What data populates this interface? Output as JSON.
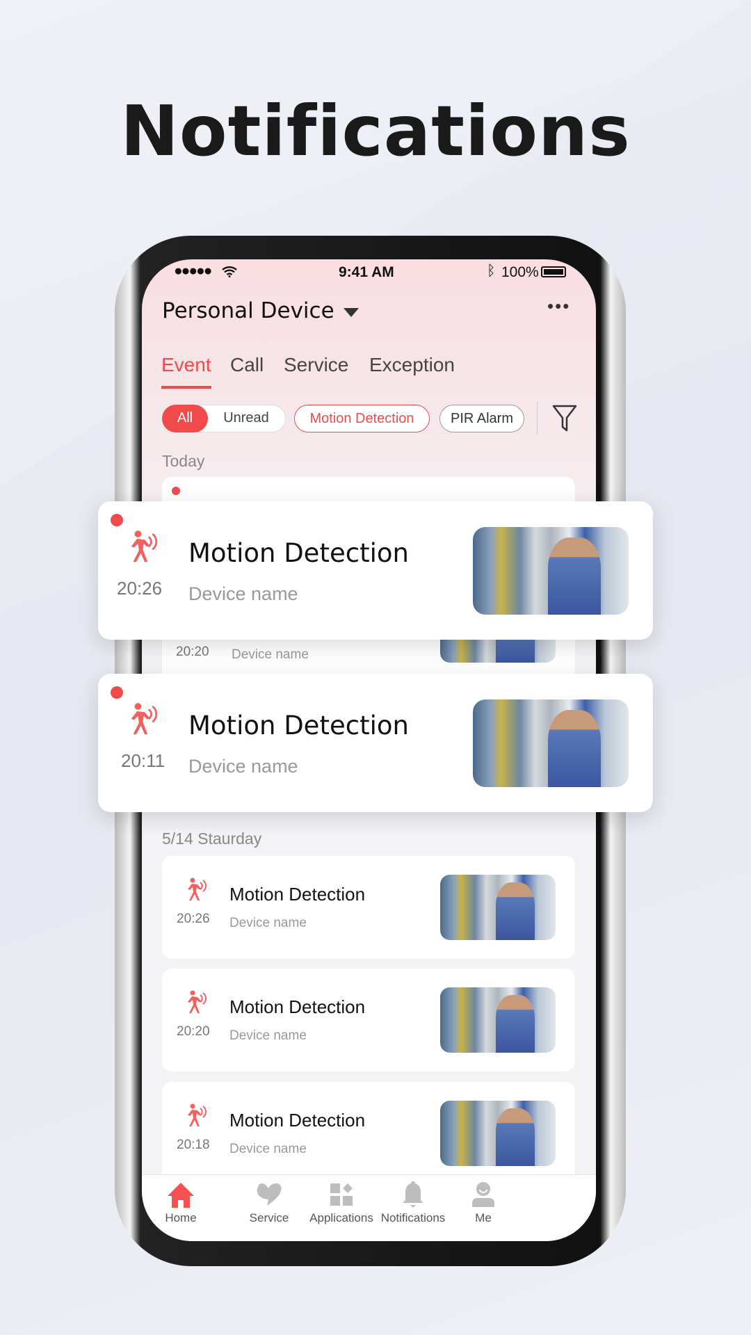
{
  "headline": "Notifications",
  "status_bar": {
    "time": "9:41 AM",
    "battery": "100%"
  },
  "header": {
    "title": "Personal Device"
  },
  "tabs": [
    {
      "label": "Event",
      "active": true
    },
    {
      "label": "Call"
    },
    {
      "label": "Service"
    },
    {
      "label": "Exception"
    }
  ],
  "filters": {
    "all": "All",
    "unread": "Unread",
    "chips": [
      "Motion Detection",
      "PIR Alarm"
    ]
  },
  "sections": {
    "today": "Today",
    "earlier": "5/14 Staurday"
  },
  "today_items": [
    {
      "title": "Motion Detection",
      "device": "Device name",
      "time": "20:26",
      "unread": true
    },
    {
      "title": "Motion Detection",
      "device": "Device name",
      "time": "20:20",
      "unread": false
    },
    {
      "title": "Motion Detection",
      "device": "Device name",
      "time": "20:11",
      "unread": true
    }
  ],
  "earlier_items": [
    {
      "title": "Motion Detection",
      "device": "Device name",
      "time": "20:26"
    },
    {
      "title": "Motion Detection",
      "device": "Device name",
      "time": "20:20"
    },
    {
      "title": "Motion Detection",
      "device": "Device name",
      "time": "20:18"
    }
  ],
  "bottom_nav": [
    {
      "label": "Home",
      "icon": "home-icon",
      "active": true
    },
    {
      "label": "Service",
      "icon": "heart-icon"
    },
    {
      "label": "Applications",
      "icon": "apps-icon"
    },
    {
      "label": "Notifications",
      "icon": "bell-icon"
    },
    {
      "label": "Me",
      "icon": "user-icon"
    }
  ],
  "colors": {
    "accent": "#f04a4a",
    "background": "#eceef5"
  }
}
